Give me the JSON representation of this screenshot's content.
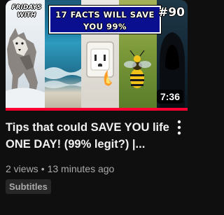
{
  "video": {
    "title": "Tips that could SAVE YOU life ONE DAY! (99% legit?) |...",
    "views": "2 views",
    "age": "13 minutes ago",
    "badge": "Subtitles",
    "duration": "7:36",
    "watch_progress": 1.0,
    "progress_color": "#ff0033"
  },
  "thumbnail": {
    "channel_logo_line1": "FRIDAYS",
    "channel_logo_line2": "WITH",
    "banner_line1": "17 FACTS WILL SAVE",
    "banner_line2": "YOU 99%",
    "episode": "#90"
  },
  "icons": {
    "menu": "more-vert-icon"
  },
  "colors": {
    "background": "#0f0f0f",
    "title_text": "#f1f1f1",
    "meta_text": "#aaaaaa",
    "badge_bg": "#272727",
    "banner_bg": "#0a0f8f"
  }
}
